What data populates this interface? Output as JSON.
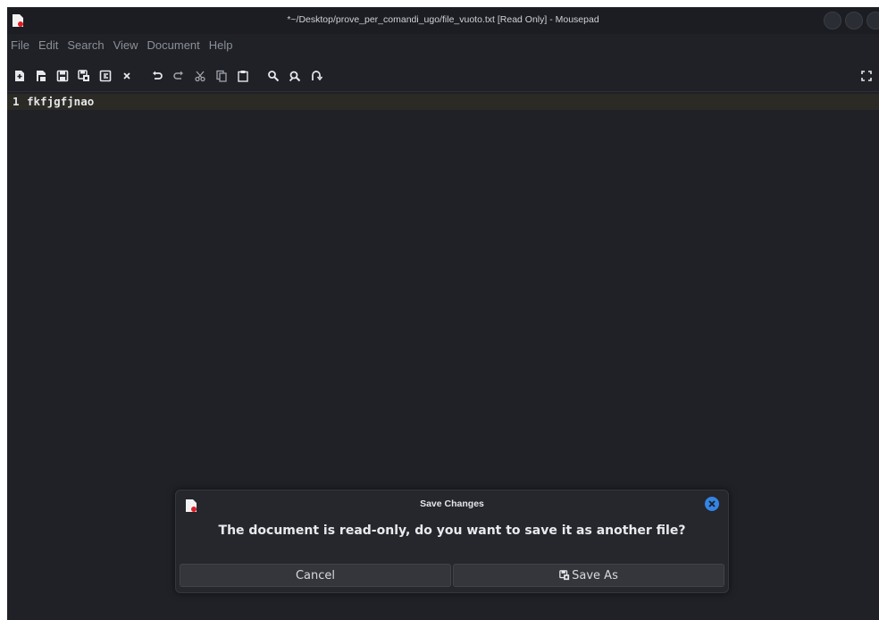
{
  "window": {
    "title": "*~/Desktop/prove_per_comandi_ugo/file_vuoto.txt [Read Only] - Mousepad",
    "accent": "#3584e4",
    "background": "#1f2127"
  },
  "menubar": {
    "items": [
      "File",
      "Edit",
      "Search",
      "View",
      "Document",
      "Help"
    ]
  },
  "toolbar": {
    "icons": [
      "new-document-icon",
      "open-icon",
      "save-icon",
      "save-as-icon",
      "reload-icon",
      "close-tab-icon",
      "undo-icon",
      "redo-icon",
      "cut-icon",
      "copy-icon",
      "paste-icon",
      "find-icon",
      "find-replace-icon",
      "go-to-icon",
      "fullscreen-icon"
    ]
  },
  "editor": {
    "lines": [
      {
        "number": "1",
        "text": "fkfjgfjnao"
      }
    ]
  },
  "dialog": {
    "title": "Save Changes",
    "message": "The document is read-only, do you want to save it as another file?",
    "cancel_label": "Cancel",
    "save_as_label": "Save As"
  }
}
